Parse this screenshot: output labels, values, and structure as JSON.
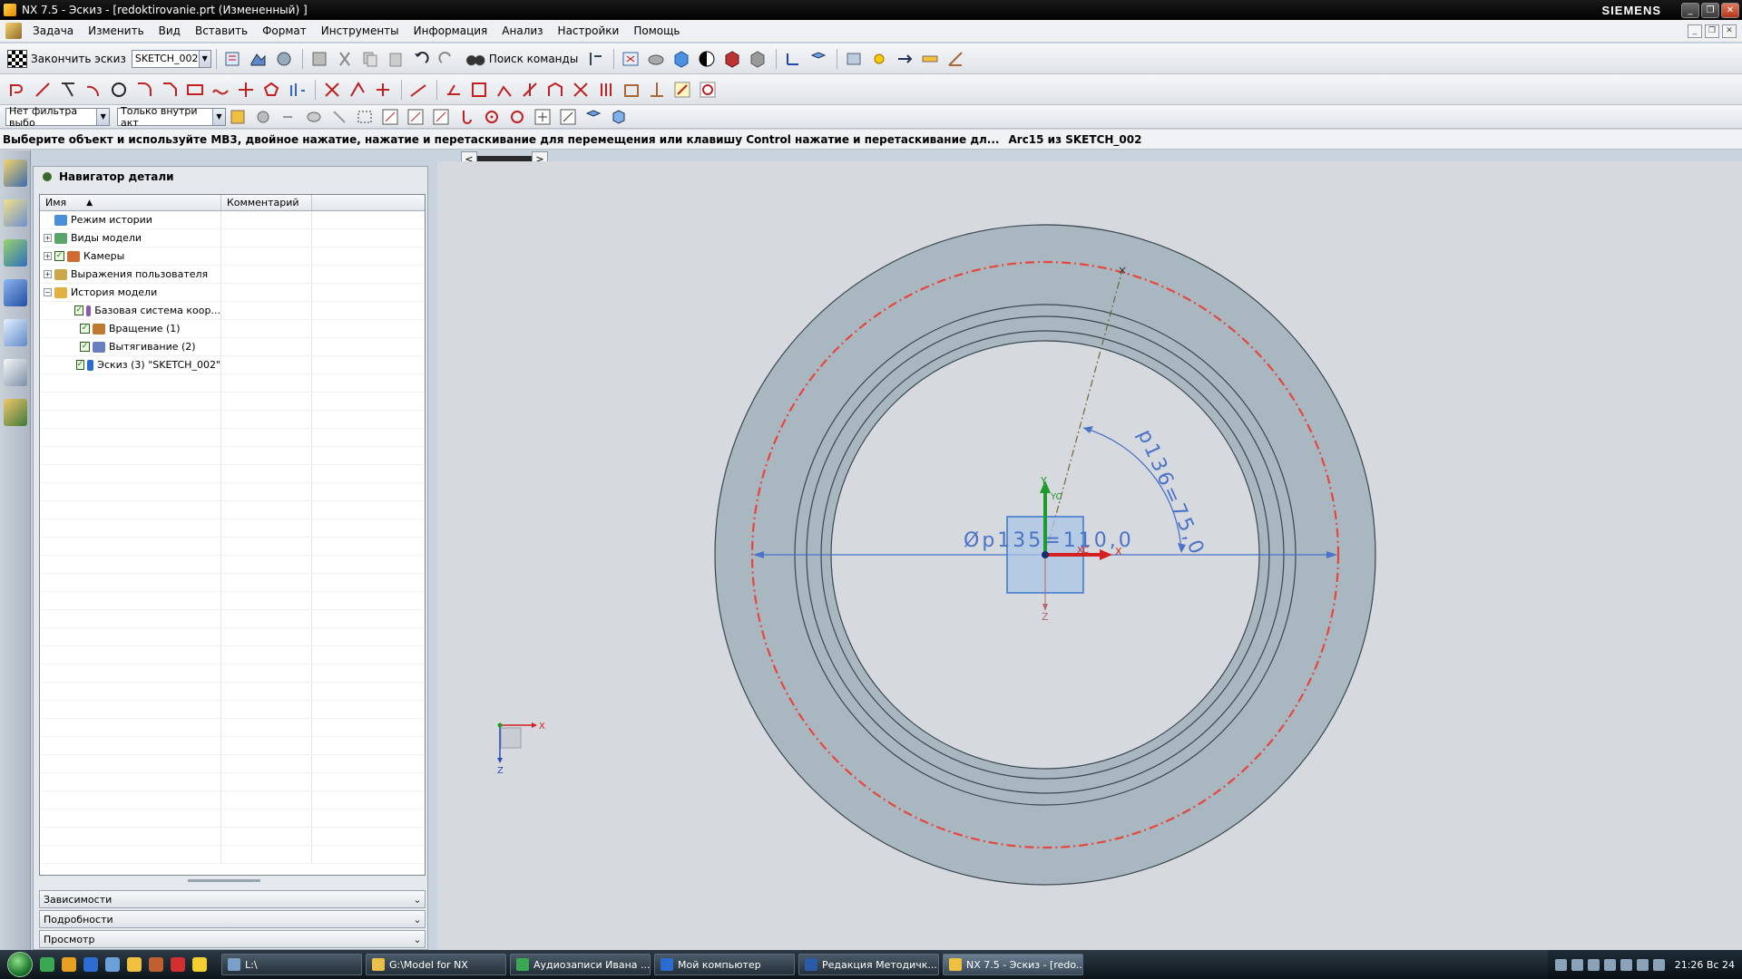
{
  "window": {
    "title": "NX 7.5 - Эскиз - [redoktirovanie.prt (Измененный) ]",
    "brand": "SIEMENS"
  },
  "menu": [
    "Задача",
    "Изменить",
    "Вид",
    "Вставить",
    "Формат",
    "Инструменты",
    "Информация",
    "Анализ",
    "Настройки",
    "Помощь"
  ],
  "toolbar": {
    "finish_label": "Закончить эскиз",
    "sketch_name": "SKETCH_002",
    "command_search": "Поиск команды"
  },
  "filters": {
    "selection_filter": "Нет фильтра выбо",
    "scope": "Только внутри акт"
  },
  "status": {
    "prompt": "Выберите объект и используйте MB3, двойное нажатие, нажатие и перетаскивание для перемещения или клавишу Control нажатие и перетаскивание дл...",
    "selection": "Arc15 из SKETCH_002"
  },
  "navigator": {
    "title": "Навигатор детали",
    "columns": [
      "Имя",
      "Комментарий"
    ],
    "tree": [
      {
        "label": "Режим истории",
        "level": 0,
        "expander": "",
        "check": false
      },
      {
        "label": "Виды модели",
        "level": 0,
        "expander": "+",
        "check": false
      },
      {
        "label": "Камеры",
        "level": 0,
        "expander": "+",
        "check": true
      },
      {
        "label": "Выражения пользователя",
        "level": 0,
        "expander": "+",
        "check": false
      },
      {
        "label": "История модели",
        "level": 0,
        "expander": "−",
        "check": false
      },
      {
        "label": "Базовая система коор...",
        "level": 1,
        "expander": "",
        "check": true
      },
      {
        "label": "Вращение (1)",
        "level": 1,
        "expander": "",
        "check": true
      },
      {
        "label": "Вытягивание (2)",
        "level": 1,
        "expander": "",
        "check": true
      },
      {
        "label": "Эскиз (3) \"SKETCH_002\"",
        "level": 1,
        "expander": "",
        "check": true
      }
    ],
    "panels": [
      "Зависимости",
      "Подробности",
      "Просмотр"
    ]
  },
  "sketch": {
    "diameter_dim": "Øp135=110,0",
    "angle_dim": "p136=75,0",
    "axis_x": "X",
    "axis_y": "Y",
    "axis_z": "Z",
    "axis_xc": "XC",
    "axis_yc": "YC",
    "colors": {
      "ring": "#a9b7c1",
      "constraint": "#e8453c",
      "dimension": "#4a73c9",
      "axis_x": "#d42020",
      "axis_y": "#1f9a2c"
    }
  },
  "triad": {
    "x": "X",
    "z": "Z"
  },
  "taskbar": {
    "tasks": [
      {
        "label": "L:\\",
        "active": false
      },
      {
        "label": "G:\\Model for NX",
        "active": false
      },
      {
        "label": "Аудиозаписи Ивана ...",
        "active": false
      },
      {
        "label": "Мой компьютер",
        "active": false
      },
      {
        "label": "Редакция Методичк...",
        "active": false
      },
      {
        "label": "NX 7.5 - Эскиз - [redo...",
        "active": true
      }
    ],
    "clock": "21:26 Вс 24"
  }
}
